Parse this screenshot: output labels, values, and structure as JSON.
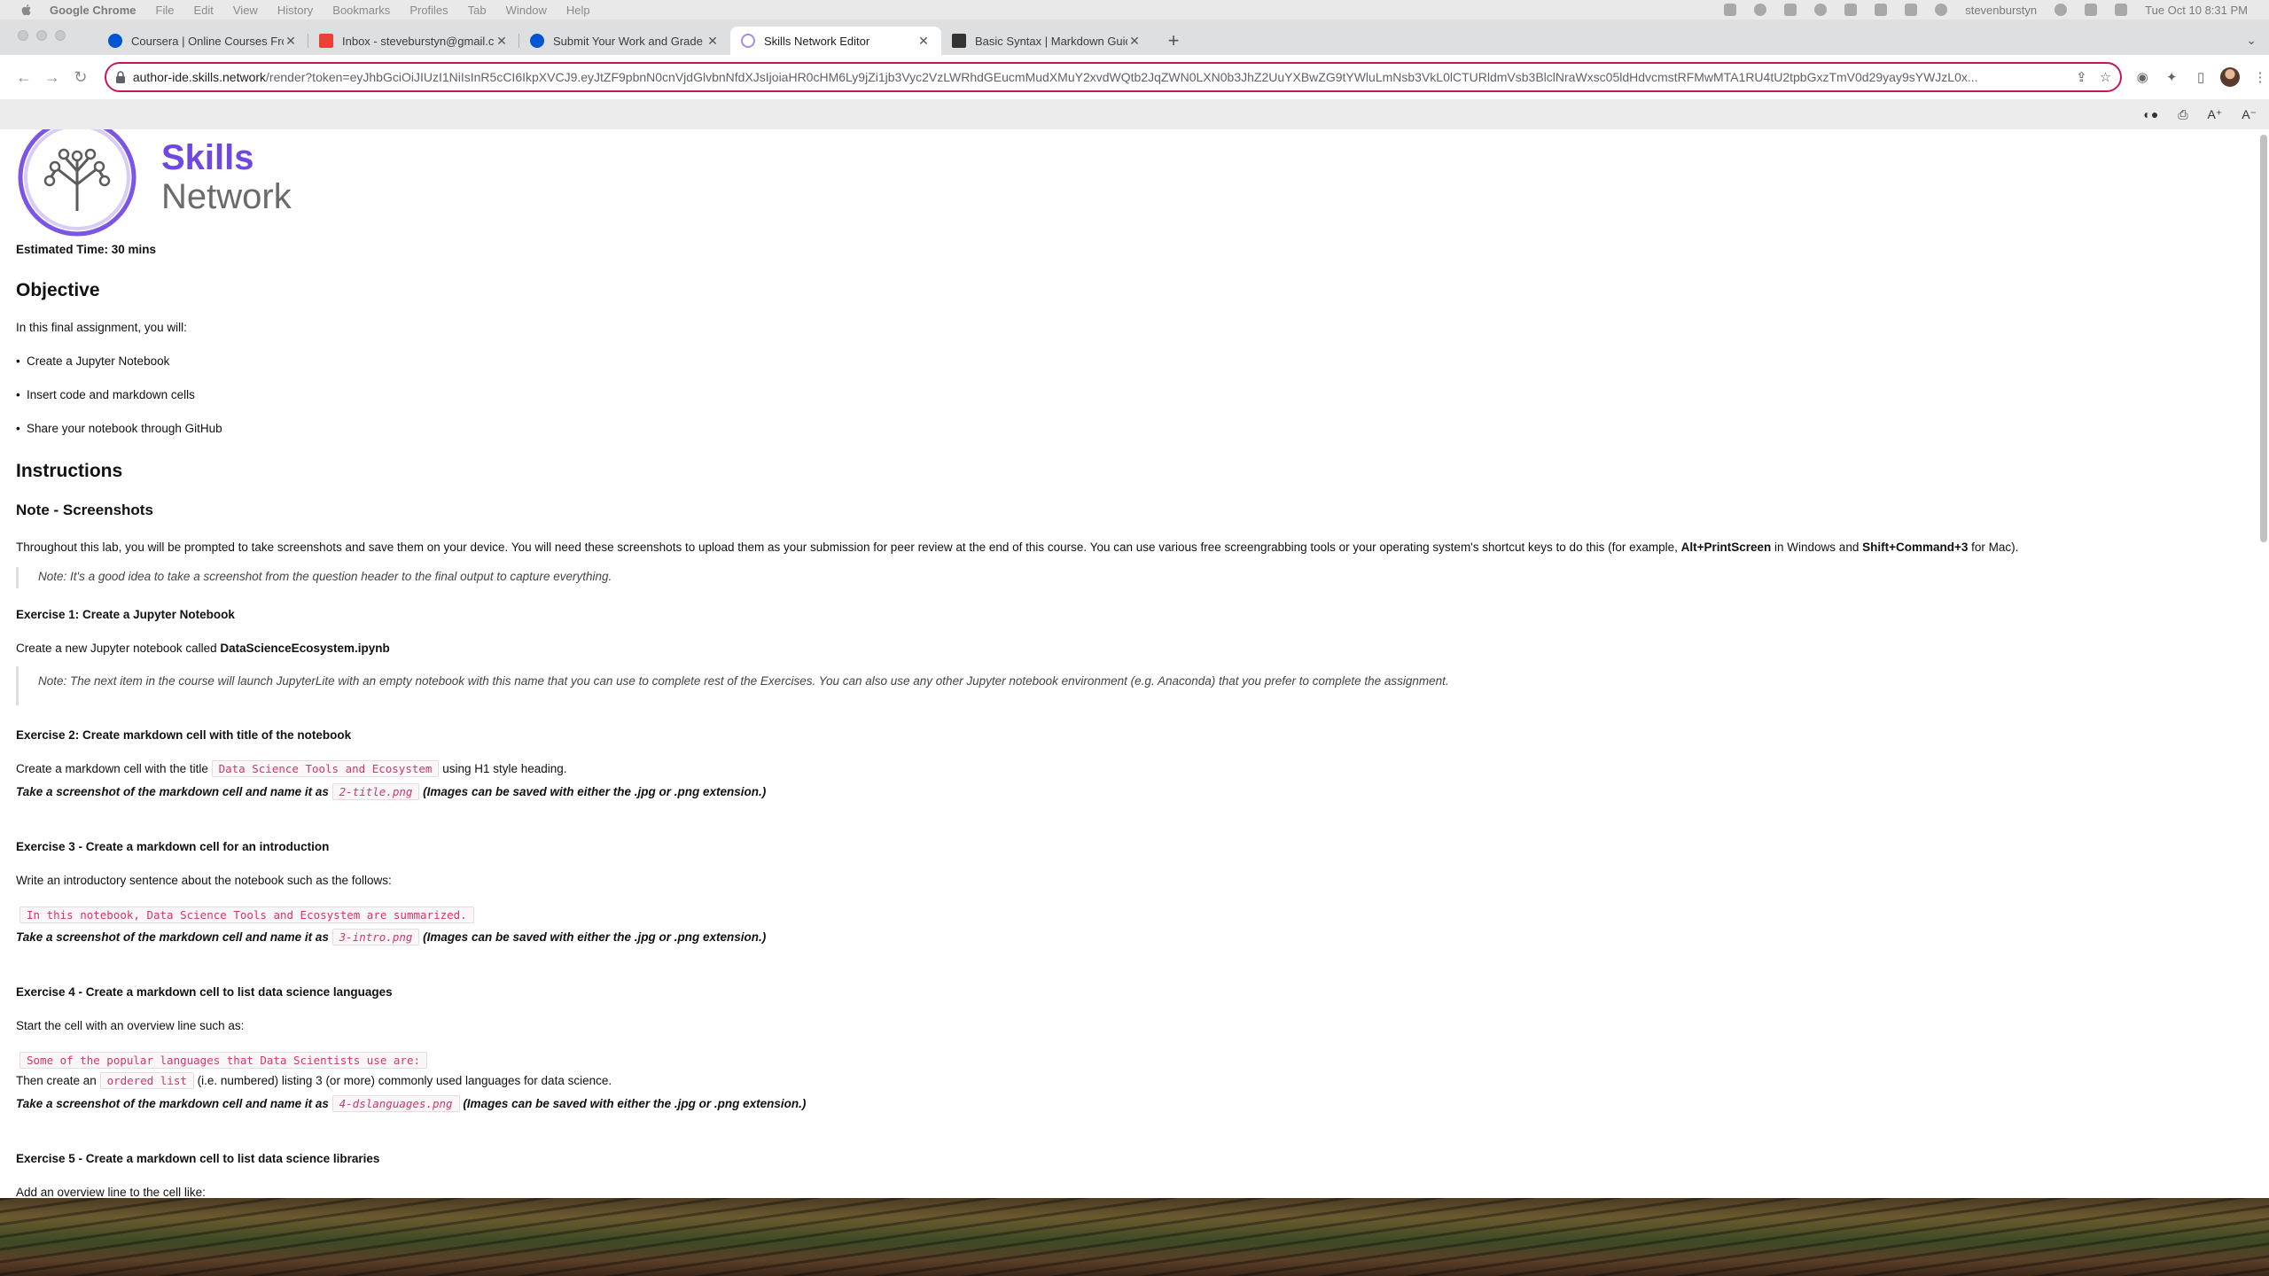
{
  "menubar": {
    "app_name": "Google Chrome",
    "items": [
      "File",
      "Edit",
      "View",
      "History",
      "Bookmarks",
      "Profiles",
      "Tab",
      "Window",
      "Help"
    ],
    "user": "stevenburstyn",
    "datetime": "Tue Oct 10  8:31 PM"
  },
  "tabs": [
    {
      "title": "Coursera | Online Courses Fro",
      "favicon": "coursera-icon",
      "color": "#0056d2",
      "active": false
    },
    {
      "title": "Inbox - steveburstyn@gmail.c",
      "favicon": "gmail-icon",
      "color": "#ea4335",
      "active": false
    },
    {
      "title": "Submit Your Work and Grade",
      "favicon": "coursera-icon",
      "color": "#0056d2",
      "active": false
    },
    {
      "title": "Skills Network Editor",
      "favicon": "skills-network-icon",
      "color": "#a78be6",
      "active": true
    },
    {
      "title": "Basic Syntax | Markdown Guid",
      "favicon": "markdown-icon",
      "color": "#333333",
      "active": false
    }
  ],
  "omnibox": {
    "host": "author-ide.skills.network",
    "path": "/render?token=eyJhbGciOiJIUzI1NiIsInR5cCI6IkpXVCJ9.eyJtZF9pbnN0cnVjdGlvbnNfdXJsIjoiaHR0cHM6Ly9jZi1jb3Vyc2VzLWRhdGEucmMudXMuY2xvdWQtb2JqZWN0LXN0b3JhZ2UuYXBwZG9tYWluLmNsb3VkL0lCTURldmVsb3BlclNraWxsc05ldHdvcmstRFMwMTA1RU4tU2tpbGxzTmV0d29yay9sYWJzL0x..."
  },
  "page": {
    "logo": {
      "line1": "Skills",
      "line2": "Network"
    },
    "estimated_time": "Estimated Time: 30 mins",
    "objective_heading": "Objective",
    "objective_intro": "In this final assignment, you will:",
    "objective_items": [
      "Create a Jupyter Notebook",
      "Insert code and markdown cells",
      "Share your notebook through GitHub"
    ],
    "instructions_heading": "Instructions",
    "note_heading": "Note - Screenshots",
    "screenshots_text_a": "Throughout this lab, you will be prompted to take screenshots and save them on your device. You will need these screenshots to upload them as your submission for peer review at the end of this course. You can use various free screengrabbing tools or your operating system's shortcut keys to do this (for example, ",
    "screenshots_key_win": "Alt+PrintScreen",
    "screenshots_text_b": " in Windows and ",
    "screenshots_key_mac": "Shift+Command+3",
    "screenshots_text_c": " for Mac).",
    "note1": "Note: It's a good idea to take a screenshot from the question header to the final output to capture everything.",
    "ex1_heading": "Exercise 1: Create a Jupyter Notebook",
    "ex1_text": "Create a new Jupyter notebook called ",
    "ex1_filename": "DataScienceEcosystem.ipynb",
    "note2": "Note: The next item in the course will launch JupyterLite with an empty notebook with this name that you can use to complete rest of the Exercises. You can also use any other Jupyter notebook environment (e.g. Anaconda) that you prefer to complete the assignment.",
    "ex2_heading": "Exercise 2: Create markdown cell with title of the notebook",
    "ex2_text_a": "Create a markdown cell with the title ",
    "ex2_code": "Data Science Tools and Ecosystem",
    "ex2_text_b": " using H1 style heading.",
    "shot_prefix": "Take a screenshot of the markdown cell and name it as ",
    "shot_suffix": " (Images can be saved with either the .jpg or .png extension.)",
    "ex2_file": "2-title.png",
    "ex3_heading": "Exercise 3 - Create a markdown cell for an introduction",
    "ex3_text": "Write an introductory sentence about the notebook such as the follows:",
    "ex3_code": "In this notebook, Data Science Tools and Ecosystem are summarized.",
    "ex3_file": "3-intro.png",
    "ex4_heading": "Exercise 4 - Create a markdown cell to list data science languages",
    "ex4_text": "Start the cell with an overview line such as:",
    "ex4_code": "Some of the popular languages that Data Scientists use are:",
    "ex4_text2_a": "Then create an ",
    "ex4_code2": "ordered list",
    "ex4_text2_b": " (i.e. numbered) listing 3 (or more) commonly used languages for data science.",
    "ex4_file": "4-dslanguages.png",
    "ex5_heading": "Exercise 5 - Create a markdown cell to list data science libraries",
    "ex5_text": "Add an overview line to the cell like:"
  },
  "colors": {
    "accent": "#c2185b",
    "brand_purple": "#6f48e0",
    "code_text": "#d6336c"
  }
}
